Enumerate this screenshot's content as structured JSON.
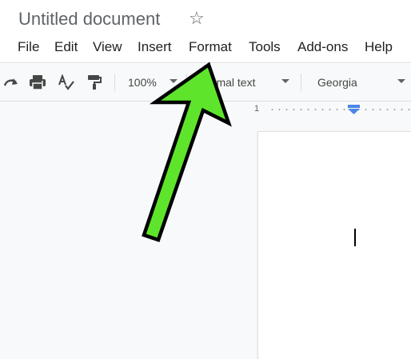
{
  "document": {
    "title": "Untitled document"
  },
  "menu": {
    "items": [
      "File",
      "Edit",
      "View",
      "Insert",
      "Format",
      "Tools",
      "Add-ons",
      "Help"
    ]
  },
  "toolbar": {
    "zoom": "100%",
    "style": "ormal text",
    "font": "Georgia"
  },
  "ruler": {
    "number": "1"
  },
  "icons": {
    "star": "star-icon",
    "redo": "redo-icon",
    "print": "print-icon",
    "spellcheck": "spellcheck-icon",
    "paint_format": "paint-format-icon",
    "annotation": "green-arrow-annotation"
  },
  "colors": {
    "arrow_fill": "#5ee52b",
    "arrow_stroke": "#000000",
    "indent_marker": "#4a86e8"
  }
}
